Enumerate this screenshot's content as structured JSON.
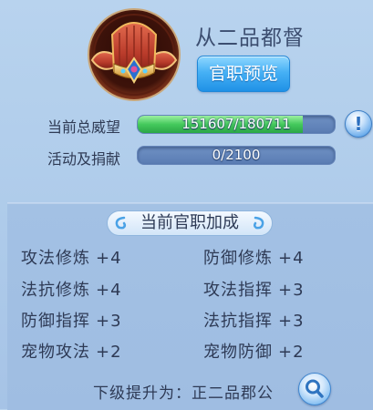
{
  "rank": {
    "title": "从二品都督",
    "preview_button": "官职预览"
  },
  "prestige": {
    "label": "当前总威望",
    "text": "151607/180711",
    "current": 151607,
    "max": 180711,
    "fill_fraction": 0.839
  },
  "contribution": {
    "label": "活动及捐献",
    "text": "0/2100",
    "current": 0,
    "max": 2100,
    "fill_fraction": 0
  },
  "info_button": "!",
  "bonus": {
    "title": "当前官职加成",
    "items": [
      {
        "name": "攻法修炼",
        "value": "+4"
      },
      {
        "name": "防御修炼",
        "value": "+4"
      },
      {
        "name": "法抗修炼",
        "value": "+4"
      },
      {
        "name": "攻法指挥",
        "value": "+3"
      },
      {
        "name": "防御指挥",
        "value": "+3"
      },
      {
        "name": "法抗指挥",
        "value": "+3"
      },
      {
        "name": "宠物攻法",
        "value": "+2"
      },
      {
        "name": "宠物防御",
        "value": "+2"
      }
    ]
  },
  "next": {
    "label": "下级提升为：",
    "rank": "正二品郡公"
  },
  "colors": {
    "accent_button": "#47b1f5",
    "progress_fill": "#44c95c",
    "text_dark": "#2e3a55"
  }
}
